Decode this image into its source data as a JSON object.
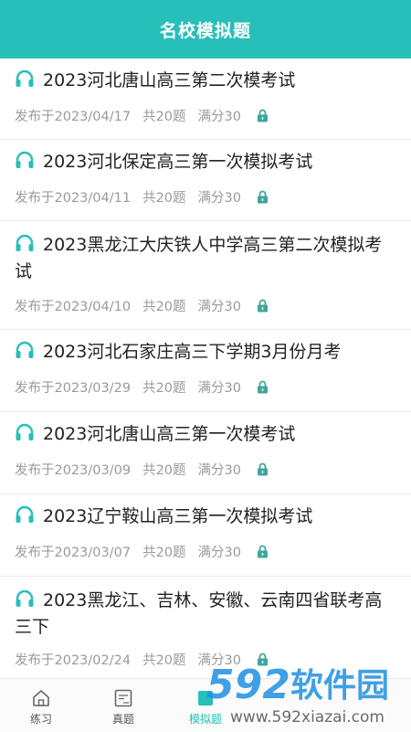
{
  "header": {
    "title": "名校模拟题"
  },
  "items": [
    {
      "title": "2023河北唐山高三第二次模考试",
      "date": "发布于2023/04/17",
      "count": "共20题",
      "score": "满分30"
    },
    {
      "title": "2023河北保定高三第一次模拟考试",
      "date": "发布于2023/04/11",
      "count": "共20题",
      "score": "满分30"
    },
    {
      "title": "2023黑龙江大庆铁人中学高三第二次模拟考试",
      "date": "发布于2023/04/10",
      "count": "共20题",
      "score": "满分30"
    },
    {
      "title": "2023河北石家庄高三下学期3月份月考",
      "date": "发布于2023/03/29",
      "count": "共20题",
      "score": "满分30"
    },
    {
      "title": "2023河北唐山高三第一次模考试",
      "date": "发布于2023/03/09",
      "count": "共20题",
      "score": "满分30"
    },
    {
      "title": "2023辽宁鞍山高三第一次模拟考试",
      "date": "发布于2023/03/07",
      "count": "共20题",
      "score": "满分30"
    },
    {
      "title": "2023黑龙江、吉林、安徽、云南四省联考高三下",
      "date": "发布于2023/02/24",
      "count": "共20题",
      "score": "满分30"
    }
  ],
  "tabbar": {
    "tabs": [
      {
        "label": "练习",
        "icon": "home-icon"
      },
      {
        "label": "真题",
        "icon": "exam-paper-icon"
      },
      {
        "label": "模拟题",
        "icon": "mock-exam-icon",
        "active": true
      }
    ]
  },
  "watermark": {
    "text": "592软件园",
    "url": "www.592xiazai.com"
  },
  "colors": {
    "accent": "#27bfb9",
    "lock": "#3fa69a",
    "meta_text": "#9a9a9a"
  }
}
